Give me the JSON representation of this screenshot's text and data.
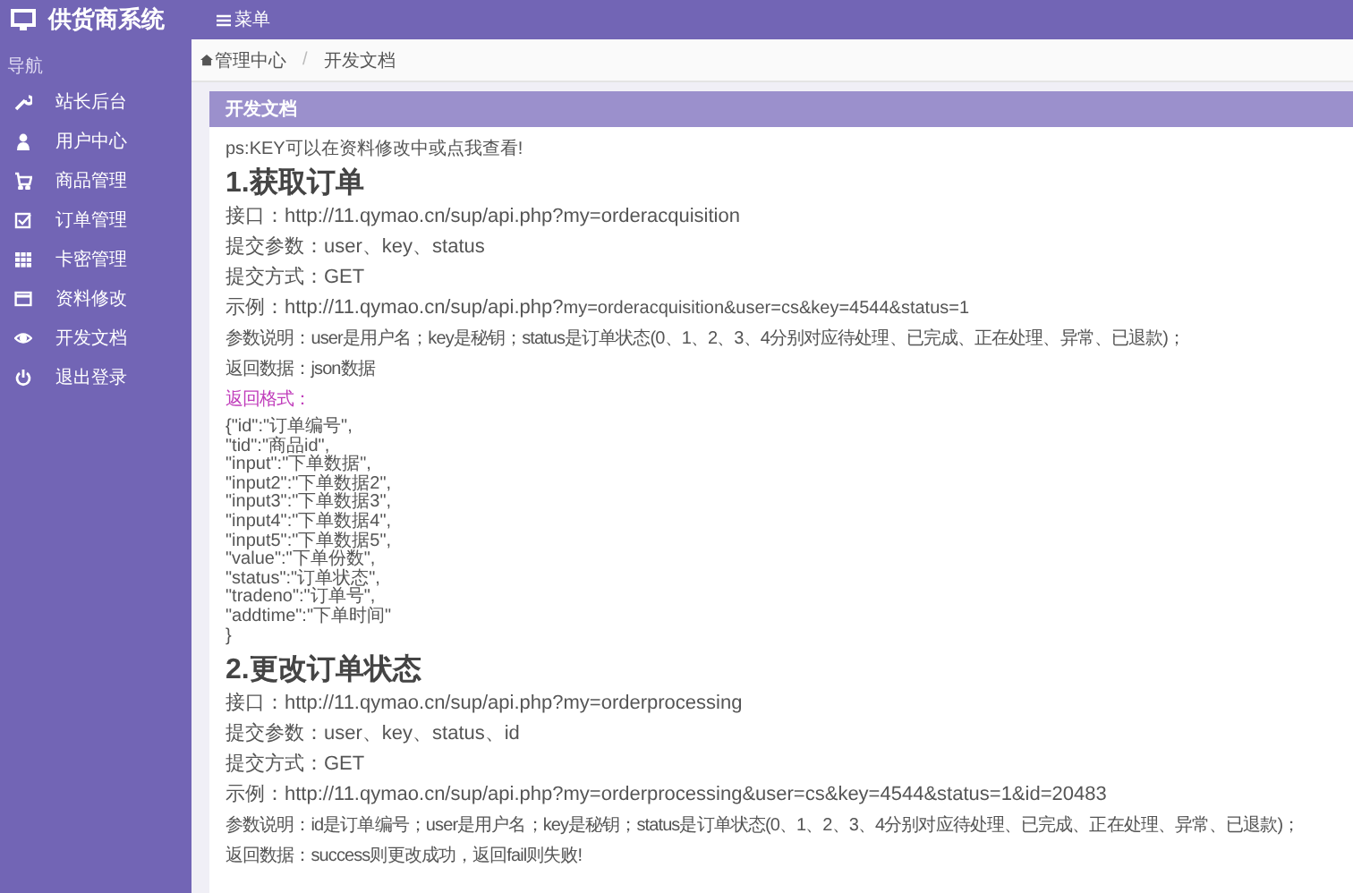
{
  "brand": {
    "title": "供货商系统"
  },
  "header": {
    "menu_label": "菜单"
  },
  "sidebar": {
    "heading": "导航",
    "items": [
      {
        "label": "站长后台"
      },
      {
        "label": "用户中心"
      },
      {
        "label": "商品管理"
      },
      {
        "label": "订单管理"
      },
      {
        "label": "卡密管理"
      },
      {
        "label": "资料修改"
      },
      {
        "label": "开发文档"
      },
      {
        "label": "退出登录"
      }
    ]
  },
  "breadcrumb": {
    "separator": "/",
    "items": [
      "管理中心",
      "开发文档"
    ]
  },
  "panel": {
    "title": "开发文档",
    "note": "ps:KEY可以在资料修改中或点我查看!",
    "sections": [
      {
        "heading": "1.获取订单",
        "lines": [
          {
            "kind": "normal",
            "text": "接口：http://11.qymao.cn/sup/api.php?my=orderacquisition"
          },
          {
            "kind": "normal",
            "text": "提交参数：user、key、status"
          },
          {
            "kind": "normal",
            "text": "提交方式：GET"
          },
          {
            "kind": "mixed",
            "text": "示例：http://11.qymao.cn/sup/api.php?",
            "small_text": "my=orderacquisition&user=cs&key=4544&status=1"
          },
          {
            "kind": "small",
            "text": "参数说明：user是用户名；key是秘钥；status是订单状态(0、1、2、3、4分别对应待处理、已完成、正在处理、异常、已退款)；"
          },
          {
            "kind": "small",
            "text": "返回数据：json数据"
          },
          {
            "kind": "accent",
            "text": "返回格式："
          },
          {
            "kind": "code",
            "lines": [
              "{\"id\":\"订单编号\",",
              "\"tid\":\"商品id\",",
              "\"input\":\"下单数据\",",
              "\"input2\":\"下单数据2\",",
              "\"input3\":\"下单数据3\",",
              "\"input4\":\"下单数据4\",",
              "\"input5\":\"下单数据5\",",
              "\"value\":\"下单份数\",",
              "\"status\":\"订单状态\",",
              "\"tradeno\":\"订单号\",",
              "\"addtime\":\"下单时间\"",
              "}"
            ]
          }
        ]
      },
      {
        "heading": "2.更改订单状态",
        "lines": [
          {
            "kind": "normal",
            "text": "接口：http://11.qymao.cn/sup/api.php?my=orderprocessing"
          },
          {
            "kind": "normal",
            "text": "提交参数：user、key、status、id"
          },
          {
            "kind": "normal",
            "text": "提交方式：GET"
          },
          {
            "kind": "normal",
            "text": "示例：http://11.qymao.cn/sup/api.php?my=orderprocessing&user=cs&key=4544&status=1&id=20483"
          },
          {
            "kind": "small",
            "text": "参数说明：id是订单编号；user是用户名；key是秘钥；status是订单状态(0、1、2、3、4分别对应待处理、已完成、正在处理、异常、已退款)；"
          },
          {
            "kind": "small",
            "text": "返回数据：success则更改成功，返回fail则失败!"
          }
        ]
      }
    ]
  }
}
